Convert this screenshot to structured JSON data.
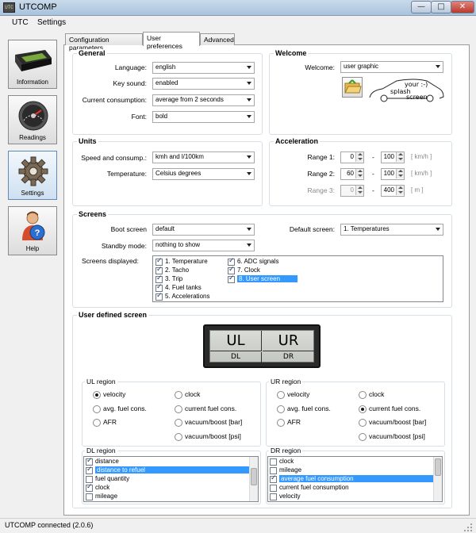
{
  "window": {
    "title": "UTCOMP",
    "app_icon": "UTC"
  },
  "menu": [
    "UTC",
    "Settings"
  ],
  "sidebar": [
    {
      "label": "Information",
      "icon": "device-display-icon"
    },
    {
      "label": "Readings",
      "icon": "gauge-icon"
    },
    {
      "label": "Settings",
      "icon": "gear-icon"
    },
    {
      "label": "Help",
      "icon": "help-person-icon"
    }
  ],
  "tabs": [
    "Configuration parameters",
    "User preferences",
    "Advanced"
  ],
  "general": {
    "title": "General",
    "language_label": "Language:",
    "language": "english",
    "key_sound_label": "Key sound:",
    "key_sound": "enabled",
    "consumption_label": "Current consumption:",
    "consumption": "average from 2 seconds",
    "font_label": "Font:",
    "font": "bold"
  },
  "welcome": {
    "title": "Welcome",
    "welcome_label": "Welcome:",
    "welcome": "user graphic",
    "splash_text_1": "your :-)",
    "splash_text_2": "splash",
    "splash_text_3": "screen"
  },
  "units": {
    "title": "Units",
    "speed_label": "Speed and consump.:",
    "speed": "kmh and l/100km",
    "temp_label": "Temperature:",
    "temp": "Celsius degrees"
  },
  "acceleration": {
    "title": "Acceleration",
    "dash": "-",
    "ranges": [
      {
        "label": "Range 1:",
        "from": "0",
        "to": "100",
        "unit": "[ km/h ]",
        "disabled": false
      },
      {
        "label": "Range 2:",
        "from": "60",
        "to": "100",
        "unit": "[ km/h ]",
        "disabled": false
      },
      {
        "label": "Range 3:",
        "from": "0",
        "to": "400",
        "unit": "[ m ]",
        "disabled": true
      }
    ]
  },
  "screens": {
    "title": "Screens",
    "boot_label": "Boot screen",
    "boot": "default",
    "standby_label": "Standby mode:",
    "standby": "nothing to show",
    "default_label": "Default screen:",
    "default": "1. Temperatures",
    "displayed_label": "Screens displayed:",
    "list_col1": [
      "1. Temperature",
      "2. Tacho",
      "3. Trip",
      "4. Fuel tanks",
      "5. Accelerations"
    ],
    "list_col2": [
      "6. ADC signals",
      "7. Clock",
      "8. User screen"
    ]
  },
  "user_screen": {
    "title": "User defined screen",
    "lcd": {
      "ul": "UL",
      "ur": "UR",
      "dl": "DL",
      "dr": "DR"
    },
    "ul_region": {
      "title": "UL region",
      "col1": [
        "velocity",
        "avg. fuel cons.",
        "AFR"
      ],
      "col2": [
        "clock",
        "current fuel cons.",
        "vacuum/boost [bar]",
        "vacuum/boost [psi]"
      ],
      "selected": "velocity"
    },
    "ur_region": {
      "title": "UR region",
      "col1": [
        "velocity",
        "avg. fuel cons.",
        "AFR"
      ],
      "col2": [
        "clock",
        "current fuel cons.",
        "vacuum/boost [bar]",
        "vacuum/boost [psi]"
      ],
      "selected": "current fuel cons."
    },
    "dl_region": {
      "title": "DL region",
      "items": [
        "distance",
        "distance to refuel",
        "fuel quantity",
        "clock",
        "mileage"
      ],
      "checked": [
        true,
        true,
        false,
        true,
        false
      ],
      "selected_index": 1
    },
    "dr_region": {
      "title": "DR region",
      "items": [
        "clock",
        "mileage",
        "average fuel consumption",
        "current fuel consumption",
        "velocity"
      ],
      "checked": [
        false,
        false,
        true,
        false,
        false
      ],
      "selected_index": 2
    }
  },
  "status": "UTCOMP connected (2.0.6)"
}
